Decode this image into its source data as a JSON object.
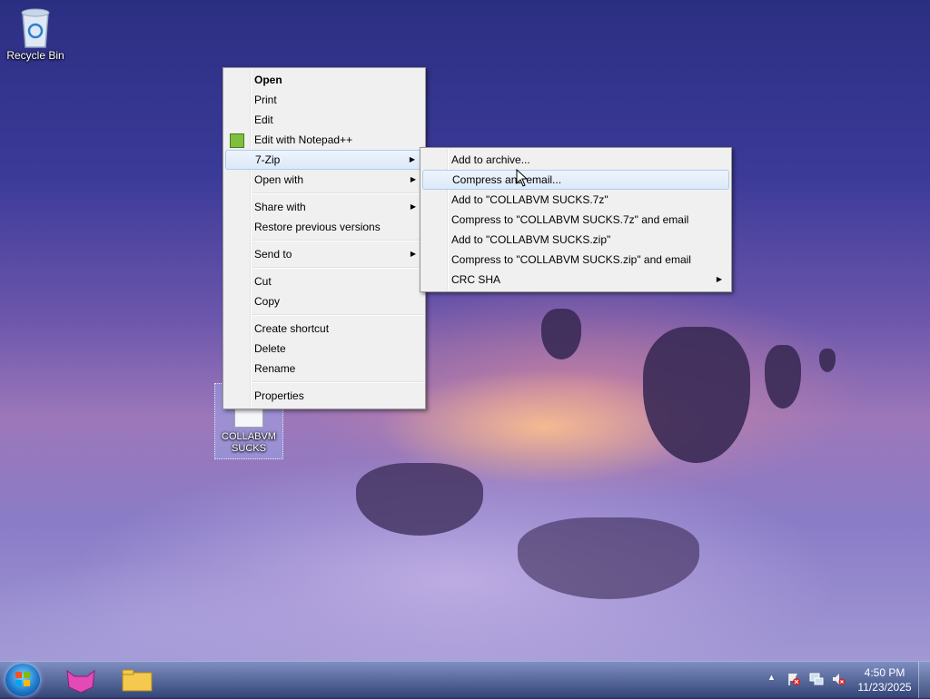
{
  "desktop": {
    "recycle_bin_label": "Recycle Bin",
    "file_icon_label": "COLLABVM SUCKS"
  },
  "context_menu": {
    "items": [
      {
        "label": "Open",
        "bold": true
      },
      {
        "label": "Print"
      },
      {
        "label": "Edit"
      },
      {
        "label": "Edit with Notepad++"
      },
      {
        "label": "7-Zip",
        "submenu": true,
        "highlighted": true
      },
      {
        "label": "Open with",
        "submenu": true
      },
      {
        "label": "Share with",
        "submenu": true
      },
      {
        "label": "Restore previous versions"
      },
      {
        "label": "Send to",
        "submenu": true
      },
      {
        "label": "Cut"
      },
      {
        "label": "Copy"
      },
      {
        "label": "Create shortcut"
      },
      {
        "label": "Delete"
      },
      {
        "label": "Rename"
      },
      {
        "label": "Properties"
      }
    ]
  },
  "zip_submenu": {
    "items": [
      {
        "label": "Add to archive..."
      },
      {
        "label": "Compress and email...",
        "highlighted": true
      },
      {
        "label": "Add to \"COLLABVM SUCKS.7z\""
      },
      {
        "label": "Compress to \"COLLABVM SUCKS.7z\" and email"
      },
      {
        "label": "Add to \"COLLABVM SUCKS.zip\""
      },
      {
        "label": "Compress to \"COLLABVM SUCKS.zip\" and email"
      },
      {
        "label": "CRC SHA",
        "submenu": true
      }
    ]
  },
  "taskbar": {
    "clock_time": "4:50 PM",
    "clock_date": "11/23/2025",
    "tray_icons": [
      "show-hidden-icons",
      "action-center-flag-icon",
      "network-icon",
      "volume-muted-icon"
    ],
    "pinned": [
      "start-button",
      "collabvm-app-icon",
      "windows-explorer-icon"
    ]
  },
  "colors": {
    "menu_bg": "#f0f0f0",
    "highlight_border": "#aeccf0"
  }
}
